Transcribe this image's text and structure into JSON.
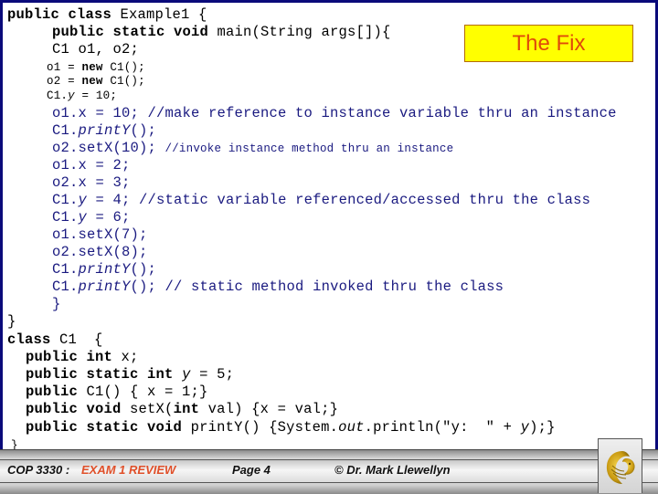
{
  "callout": {
    "label": "The Fix",
    "bg_color": "#ffff00",
    "text_color": "#e04a0a"
  },
  "code": {
    "l1": {
      "kw": "public class",
      "rest": " Example1 {"
    },
    "l2": {
      "kw": "public static void",
      "rest": " main(String args[]){"
    },
    "l3": {
      "text": "C1 o1, o2;"
    },
    "l4": {
      "a": "o1 = ",
      "kw": "new",
      "b": " C1();"
    },
    "l5": {
      "a": "o2 = ",
      "kw": "new",
      "b": " C1();"
    },
    "l6": {
      "a": "C1.",
      "it": "y",
      "b": " = 10;"
    },
    "l7": {
      "text": "o1.x = 10; //make reference to instance variable thru an instance"
    },
    "l8": {
      "a": "C1.",
      "it": "printY",
      "b": "();"
    },
    "l9": {
      "a": "o2.setX(10); ",
      "cmt": "//invoke instance method thru an instance"
    },
    "l10": {
      "text": "o1.x = 2;"
    },
    "l11": {
      "text": "o2.x = 3;"
    },
    "l12": {
      "a": "C1.",
      "it": "y",
      "b": " = 4; //static variable referenced/accessed thru the class"
    },
    "l13": {
      "a": "C1.",
      "it": "y",
      "b": " = 6;"
    },
    "l14": {
      "text": "o1.setX(7);"
    },
    "l15": {
      "text": "o2.setX(8);"
    },
    "l16": {
      "a": "C1.",
      "it": "printY",
      "b": "();"
    },
    "l17": {
      "a": "C1.",
      "it": "printY",
      "b": "(); // static method invoked thru the class"
    },
    "l18": {
      "text": "}"
    },
    "l19": {
      "text": "}"
    },
    "l20": {
      "kw": "class",
      "rest": " C1  {"
    },
    "l21": {
      "kw1": "public",
      "kw2": "int",
      "rest": " x;"
    },
    "l22": {
      "kw1": "public",
      "kw2": "static int",
      "it": "y",
      "rest": " = 5;"
    },
    "l23": {
      "kw1": "public",
      "rest": "C1() { x = 1;}"
    },
    "l24": {
      "kw1": "public",
      "kw2": "void",
      "a": " setX(",
      "kw3": "int",
      "b": " val) {x = val;}"
    },
    "l25": {
      "kw1": "public",
      "kw2": "static void",
      "a": " printY() {System.",
      "it1": "out",
      "b": ".println(\"y:  \" + ",
      "it2": "y",
      "c": ");}"
    },
    "l26": {
      "text": "}"
    }
  },
  "footer": {
    "course": "COP 3330 :",
    "title": "EXAM 1 REVIEW",
    "page": "Page 4",
    "copyright": "© Dr. Mark Llewellyn",
    "logo_icon": "pegasus-logo-icon"
  }
}
